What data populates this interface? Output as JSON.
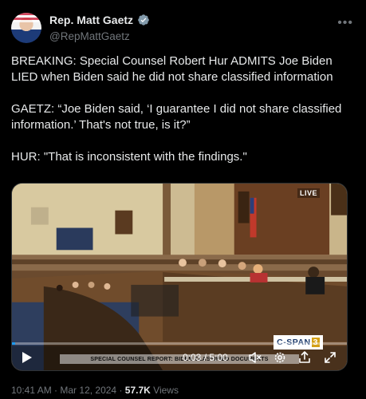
{
  "author": {
    "display_name": "Rep. Matt Gaetz",
    "handle": "@RepMattGaetz",
    "verified": true,
    "verified_color": "#829aab"
  },
  "tweet": {
    "paragraphs": [
      "BREAKING: Special Counsel Robert Hur ADMITS Joe Biden LIED when Biden said he did not share classified information",
      "GAETZ: “Joe Biden said, ‘I guarantee I did not share classified information.’ That's not true, is it?”",
      "HUR: \"That is inconsistent with the findings.\""
    ]
  },
  "video": {
    "live_label": "LIVE",
    "network_logo": "C-SPAN",
    "network_number": "3",
    "chyron": "SPECIAL COUNSEL REPORT: BIDEN CLASSIFIED DOCUMENTS",
    "time": "0:03 / 5:00",
    "progress": 0.01,
    "controls": [
      "play-icon",
      "mute-icon",
      "settings-icon",
      "share-icon",
      "fullscreen-icon"
    ]
  },
  "meta": {
    "time": "10:41 AM",
    "separator": "·",
    "date": "Mar 12, 2024",
    "views_count": "57.7K",
    "views_label": "Views"
  },
  "colors": {
    "background": "#000000",
    "text": "#e7e9ea",
    "secondary": "#71767b",
    "accent": "#1d9bf0"
  }
}
